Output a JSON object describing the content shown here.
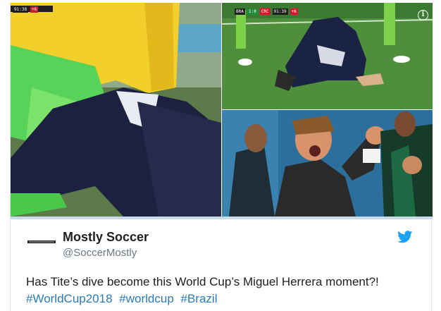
{
  "media": {
    "left_panel": {
      "scoreboard": [
        "91:38",
        "+6"
      ]
    },
    "top_right_panel": {
      "scoreboard": [
        "BRA",
        "1:0",
        "CRC",
        "91:39",
        "+6"
      ],
      "info_icon": "info-icon"
    },
    "bottom_right_panel": {}
  },
  "tweet": {
    "author_name": "Mostly Soccer",
    "author_handle": "@SoccerMostly",
    "logo_icon": "mostly-soccer-logo",
    "platform_icon": "twitter-bird-icon",
    "text": "Has Tite’s dive become this World Cup’s Miguel Herrera moment?!",
    "hashtags": [
      "#WorldCup2018",
      "#worldcup",
      "#Brazil"
    ]
  },
  "colors": {
    "link": "#2b7bb9",
    "handle": "#697882",
    "twitter_blue": "#1da1f2"
  }
}
